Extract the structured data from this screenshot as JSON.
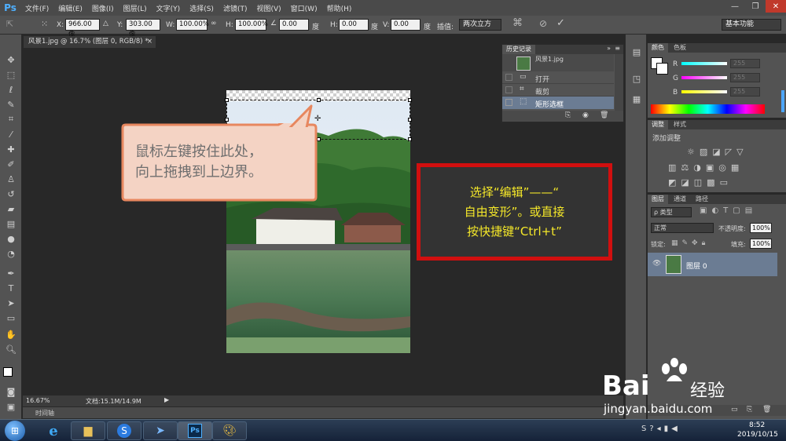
{
  "app": {
    "logo": "Ps",
    "menu": [
      "文件(F)",
      "编辑(E)",
      "图像(I)",
      "图层(L)",
      "文字(Y)",
      "选择(S)",
      "滤镜(T)",
      "视图(V)",
      "窗口(W)",
      "帮助(H)"
    ],
    "window_controls": [
      "—",
      "❐",
      "✕"
    ]
  },
  "options": {
    "x_label": "X:",
    "x_value": "966.00 像",
    "y_label": "Y:",
    "y_value": "303.00 像",
    "w_label": "W:",
    "w_value": "100.00%",
    "h_label": "H:",
    "h_value": "100.00%",
    "angle_value": "0.00",
    "angle_unit": "度",
    "hskew_label": "H:",
    "hskew_value": "0.00",
    "hskew_unit": "度",
    "vskew_label": "V:",
    "vskew_value": "0.00",
    "vskew_unit": "度",
    "interp_label": "插值:",
    "interp_value": "两次立方",
    "workspace": "基本功能"
  },
  "document": {
    "tab_title": "风景1.jpg @ 16.7% (图层 0, RGB/8) *",
    "tab_close": "×",
    "zoom": "16.67%",
    "doc_size": "文档:15.1M/14.9M",
    "timeline_label": "时间轴"
  },
  "history": {
    "title": "历史记录",
    "snapshot_name": "风景1.jpg",
    "items": [
      "打开",
      "裁剪",
      "矩形选框"
    ]
  },
  "color_panel": {
    "tabs": [
      "颜色",
      "色板"
    ],
    "r_label": "R",
    "r_value": "255",
    "g_label": "G",
    "g_value": "255",
    "b_label": "B",
    "b_value": "255"
  },
  "adjust_panel": {
    "tabs": [
      "调整",
      "样式"
    ],
    "title": "添加调整"
  },
  "layers_panel": {
    "tabs": [
      "图层",
      "通道",
      "路径"
    ],
    "filter": "ρ 类型",
    "blend_mode": "正常",
    "opacity_label": "不透明度:",
    "opacity_value": "100%",
    "lock_label": "锁定:",
    "fill_label": "填充:",
    "fill_value": "100%",
    "layer_name": "图层 0"
  },
  "callouts": {
    "bubble_line1": "鼠标左键按住此处，",
    "bubble_line2": "向上拖拽到上边界。",
    "box_line1": "选择“编辑”——“",
    "box_line2": "自由变形”。或直接",
    "box_line3": "按快捷键“Ctrl+t”"
  },
  "taskbar": {
    "time": "8:52",
    "date": "2019/10/15"
  },
  "watermark": {
    "brand": "Bai",
    "brand_cn": "经验",
    "url": "jingyan.baidu.com"
  },
  "colors": {
    "bubble_fill": "#f4d3c4",
    "bubble_border": "#e7875f",
    "box_border": "#d10f0f",
    "box_text": "#f5e829"
  }
}
